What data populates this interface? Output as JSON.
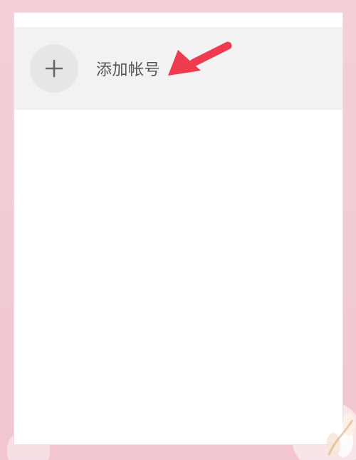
{
  "screen": {
    "background_color": "#f3cfd6",
    "panel_color": "#ffffff",
    "row_color": "#f2f2f2"
  },
  "account_menu": {
    "add_account": {
      "label": "添加帐号",
      "icon": "plus-icon"
    }
  },
  "annotation": {
    "icon": "red-arrow-icon",
    "color": "#ee3b4f"
  }
}
